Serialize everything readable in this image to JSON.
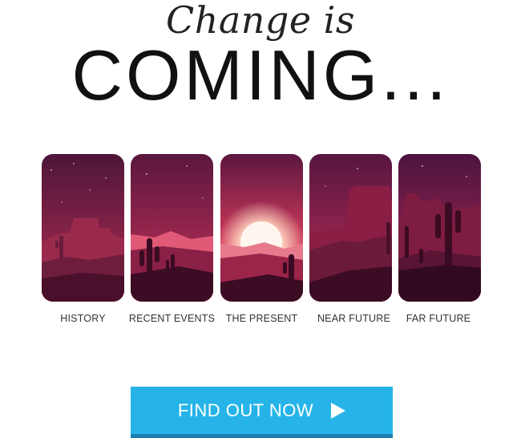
{
  "header": {
    "script_title": "Change is",
    "main_title": "COMING..."
  },
  "panels": [
    {
      "label": "HISTORY"
    },
    {
      "label": "RECENT EVENTS"
    },
    {
      "label": "THE PRESENT"
    },
    {
      "label": "NEAR FUTURE"
    },
    {
      "label": "FAR FUTURE"
    }
  ],
  "cta": {
    "label": "FIND OUT NOW",
    "icon": "play-triangle-icon",
    "color": "#26b4e8"
  },
  "colors": {
    "sky_dark": "#5e1a3f",
    "sky_mid": "#a3254d",
    "ground_dark": "#3a0b22",
    "sun": "#ffd7c0"
  }
}
